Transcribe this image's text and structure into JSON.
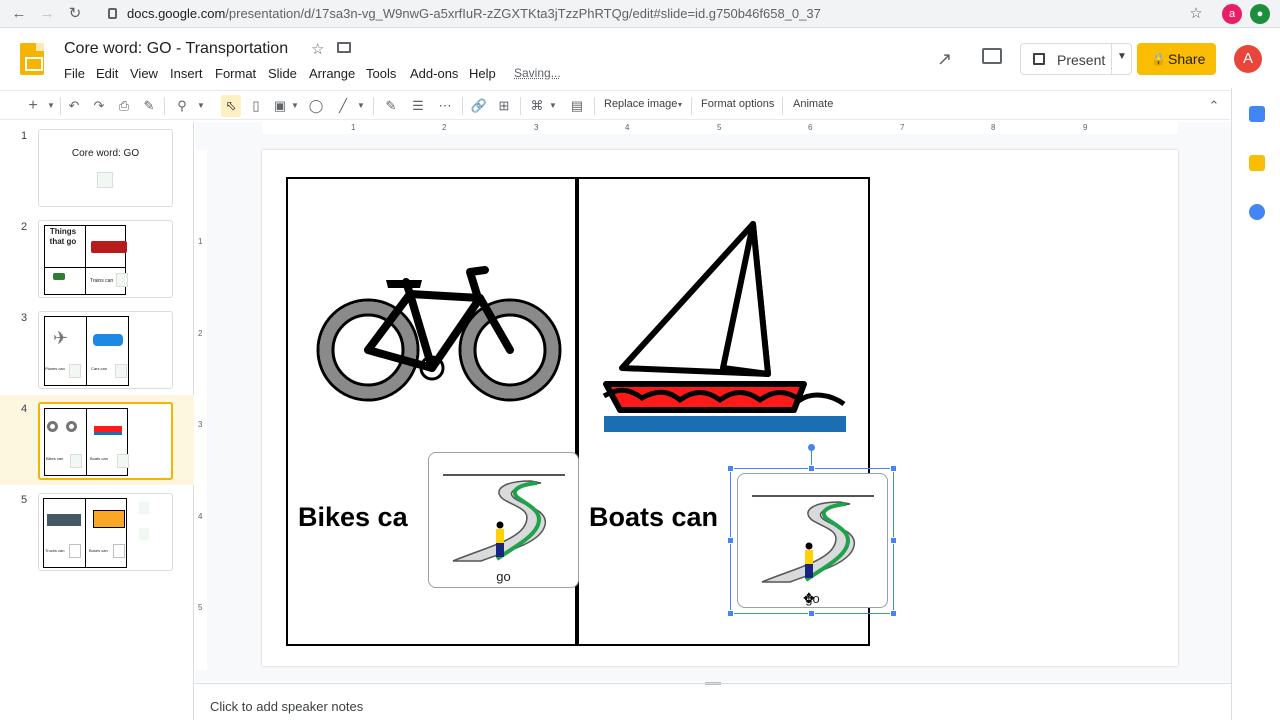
{
  "browser": {
    "url_host": "docs.google.com",
    "url_path": "/presentation/d/17sa3n-vg_W9nwG-a5xrfIuR-zZGXTKta3jTzzPhRTQg/edit#slide=id.g750b46f658_0_37",
    "profile_initial": "a"
  },
  "header": {
    "title": "Core word: GO - Transportation",
    "menu": [
      "File",
      "Edit",
      "View",
      "Insert",
      "Format",
      "Slide",
      "Arrange",
      "Tools",
      "Add-ons",
      "Help"
    ],
    "saving": "Saving...",
    "present_label": "Present",
    "share_label": "Share",
    "avatar_initial": "A"
  },
  "toolbar": {
    "replace_image": "Replace image",
    "format_options": "Format options",
    "animate": "Animate"
  },
  "ruler": {
    "h_labels": [
      "1",
      "2",
      "3",
      "4",
      "5",
      "6",
      "7",
      "8",
      "9"
    ],
    "v_labels": [
      "1",
      "2",
      "3",
      "4",
      "5"
    ]
  },
  "filmstrip": {
    "slides": [
      {
        "num": "1",
        "text": "Core word: GO"
      },
      {
        "num": "2",
        "text": "Things that go",
        "caption": "Trains can"
      },
      {
        "num": "3",
        "caption_left": "Planes can",
        "caption_right": "Cars can"
      },
      {
        "num": "4",
        "caption_left": "Bikes can",
        "caption_right": "Boats can",
        "active": true
      },
      {
        "num": "5",
        "caption_left": "Trucks can",
        "caption_right": "Buses can"
      }
    ]
  },
  "slide": {
    "left_text": "Bikes ca",
    "right_text": "Boats can",
    "go_card_label": "go",
    "go_card_selected_label": "go"
  },
  "notes": {
    "placeholder": "Click to add speaker notes"
  },
  "colors": {
    "accent_yellow": "#fbbc04",
    "selection_blue": "#4285f4",
    "active_slide_bg": "#fef7e0",
    "boat_red": "#ff1a1a",
    "water_blue": "#1a6fb3"
  }
}
